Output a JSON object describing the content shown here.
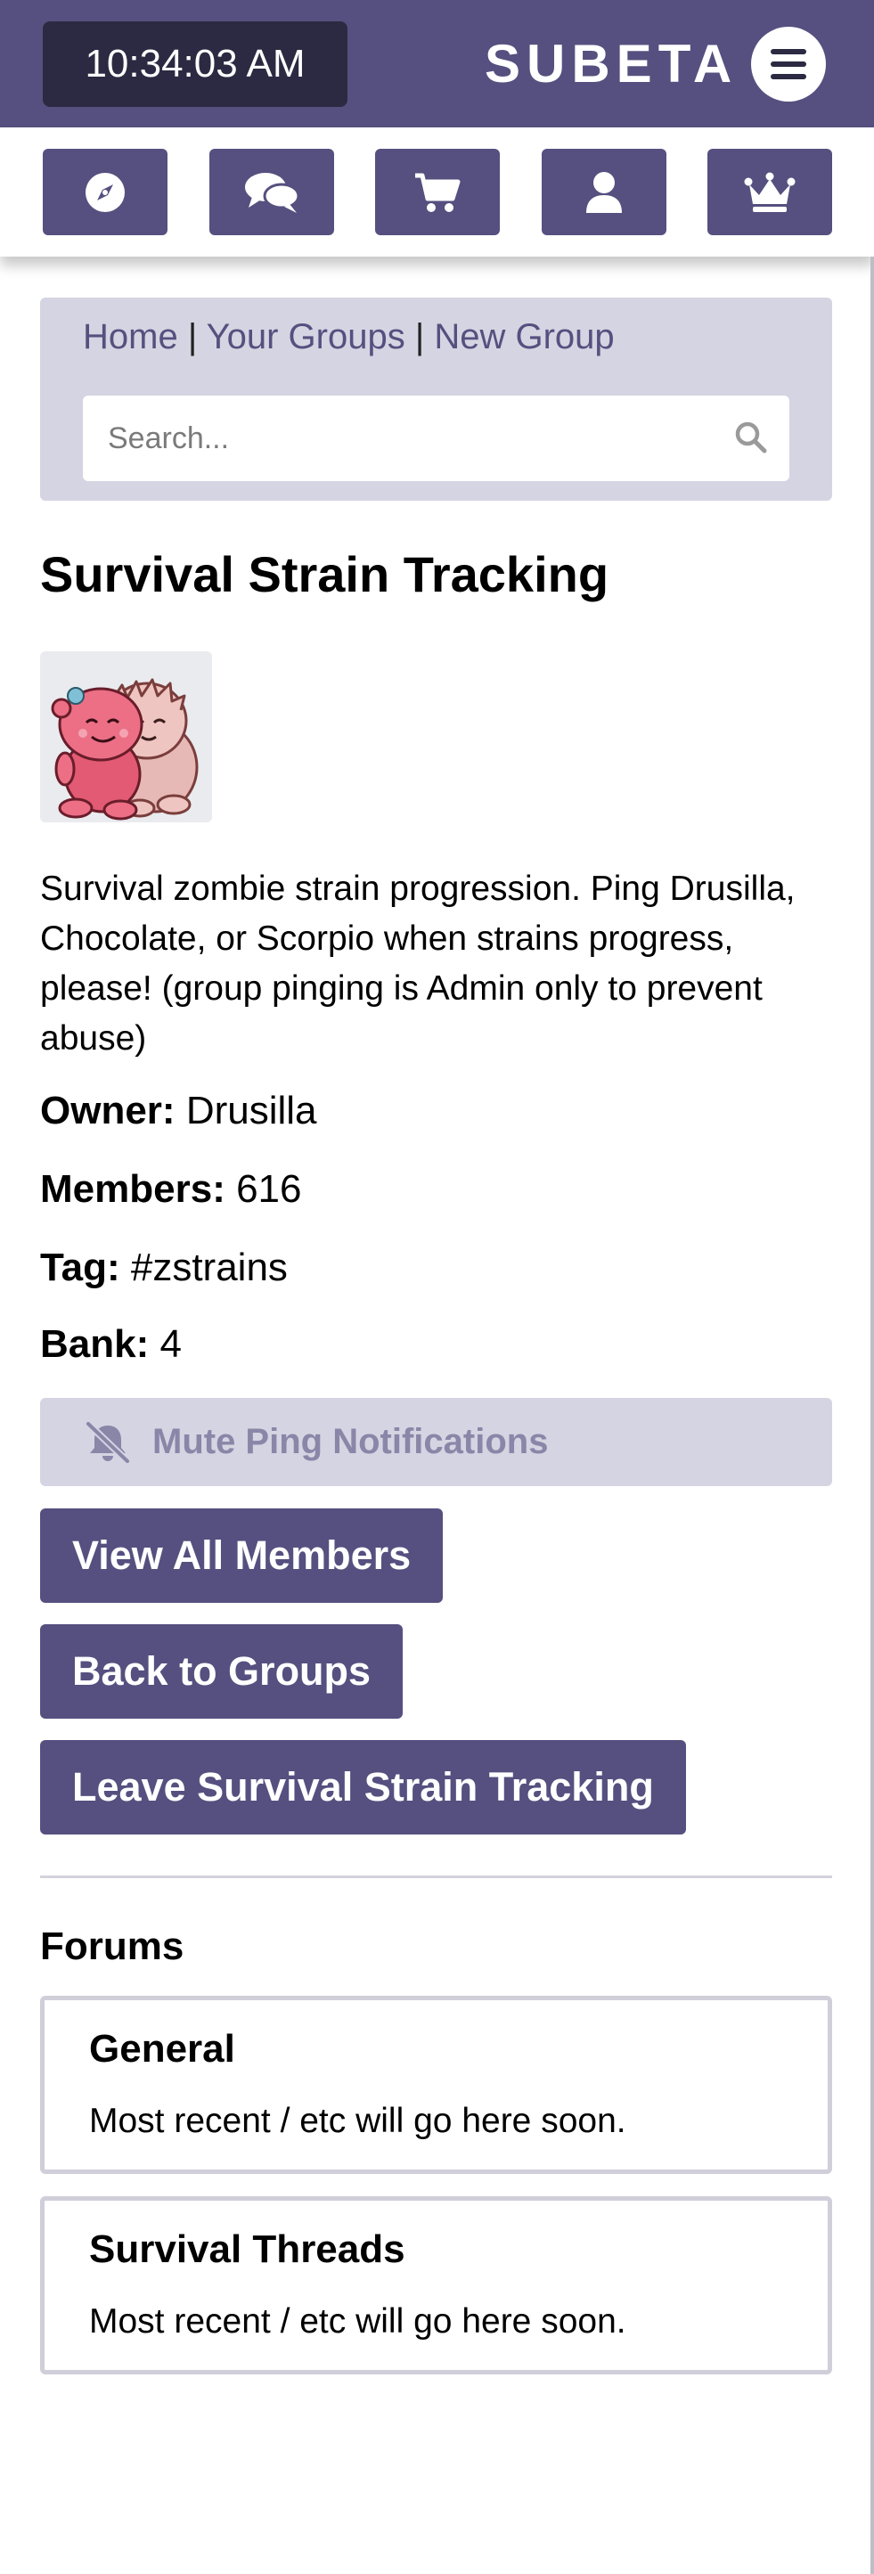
{
  "header": {
    "clock": "10:34:03 AM",
    "brand": "SUBETA",
    "colors": {
      "primary": "#55507f",
      "clock_bg": "#2b2a42",
      "muted_bg": "#d5d4e2"
    }
  },
  "nav": {
    "icons": [
      "compass-icon",
      "chat-icon",
      "cart-icon",
      "user-icon",
      "crown-icon"
    ]
  },
  "breadcrumb": {
    "home": "Home",
    "sep1": "|",
    "your_groups": "Your Groups",
    "sep2": "|",
    "new_group": "New Group"
  },
  "search": {
    "placeholder": "Search..."
  },
  "group": {
    "title": "Survival Strain Tracking",
    "description": "Survival zombie strain progression. Ping Drusilla, Chocolate, or Scorpio when strains progress, please! (group pinging is Admin only to prevent abuse)",
    "owner_label": "Owner:",
    "owner": "Drusilla",
    "members_label": "Members:",
    "members": "616",
    "tag_label": "Tag:",
    "tag": "#zstrains",
    "bank_label": "Bank:",
    "bank": "4"
  },
  "actions": {
    "mute": "Mute Ping Notifications",
    "view_members": "View All Members",
    "back": "Back to Groups",
    "leave": "Leave Survival Strain Tracking"
  },
  "forums": {
    "heading": "Forums",
    "items": [
      {
        "name": "General",
        "desc": "Most recent / etc will go here soon."
      },
      {
        "name": "Survival Threads",
        "desc": "Most recent / etc will go here soon."
      }
    ]
  }
}
